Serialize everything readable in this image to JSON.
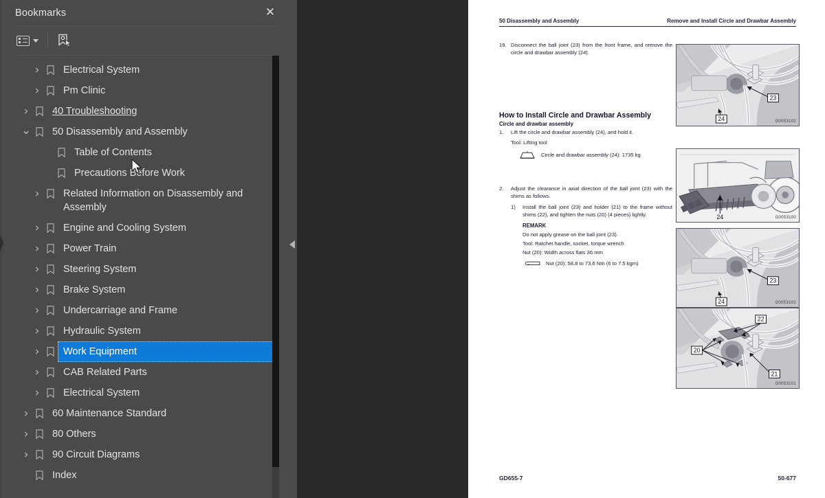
{
  "panel": {
    "title": "Bookmarks",
    "close_label": "✕",
    "toolbar": {
      "options_icon": "list-options-icon",
      "caret_icon": "chevron-down-icon",
      "new_bookmark_icon": "new-bookmark-icon"
    }
  },
  "tree": [
    {
      "label": "Electrical System",
      "level": 1,
      "twisty": "collapsed",
      "state": "normal"
    },
    {
      "label": "Pm Clinic",
      "level": 1,
      "twisty": "collapsed",
      "state": "normal"
    },
    {
      "label": "40 Troubleshooting",
      "level": 0,
      "twisty": "collapsed",
      "state": "hovered"
    },
    {
      "label": "50 Disassembly and Assembly",
      "level": 0,
      "twisty": "expanded",
      "state": "normal"
    },
    {
      "label": "Table of Contents",
      "level": 1,
      "twisty": "none",
      "state": "normal"
    },
    {
      "label": "Precautions Before Work",
      "level": 1,
      "twisty": "none",
      "state": "normal"
    },
    {
      "label": "Related Information on Disassembly and Assembly",
      "level": 1,
      "twisty": "collapsed",
      "state": "normal"
    },
    {
      "label": "Engine and Cooling System",
      "level": 1,
      "twisty": "collapsed",
      "state": "normal"
    },
    {
      "label": "Power Train",
      "level": 1,
      "twisty": "collapsed",
      "state": "normal"
    },
    {
      "label": "Steering System",
      "level": 1,
      "twisty": "collapsed",
      "state": "normal"
    },
    {
      "label": "Brake System",
      "level": 1,
      "twisty": "collapsed",
      "state": "normal"
    },
    {
      "label": "Undercarriage and Frame",
      "level": 1,
      "twisty": "collapsed",
      "state": "normal"
    },
    {
      "label": "Hydraulic System",
      "level": 1,
      "twisty": "collapsed",
      "state": "normal"
    },
    {
      "label": "Work Equipment",
      "level": 1,
      "twisty": "collapsed",
      "state": "selected"
    },
    {
      "label": "CAB Related Parts",
      "level": 1,
      "twisty": "collapsed",
      "state": "normal"
    },
    {
      "label": "Electrical System",
      "level": 1,
      "twisty": "collapsed",
      "state": "normal"
    },
    {
      "label": "60 Maintenance Standard",
      "level": 0,
      "twisty": "collapsed",
      "state": "normal"
    },
    {
      "label": "80 Others",
      "level": 0,
      "twisty": "collapsed",
      "state": "normal"
    },
    {
      "label": "90 Circuit Diagrams",
      "level": 0,
      "twisty": "collapsed",
      "state": "normal"
    },
    {
      "label": "Index",
      "level": 0,
      "twisty": "none",
      "state": "normal"
    }
  ],
  "document": {
    "header_left": "50 Disassembly and Assembly",
    "header_right": "Remove and Install Circle and Drawbar Assembly",
    "footer_left": "GD655-7",
    "footer_right": "50-677",
    "step19_num": "19.",
    "step19_text": "Disconnect the ball joint (23) from the front frame, and remove the circle and drawbar assembly (24).",
    "install_heading": "How to Install Circle and Drawbar Assembly",
    "install_subheading": "Circle and drawbar assembly",
    "step1_num": "1.",
    "step1_text": "Lift the circle and drawbar assembly (24), and hold it.",
    "step1_tool": "Tool: Lifting tool",
    "step1_weight": "Circle and drawbar assembly (24): 1735 kg",
    "step2_num": "2.",
    "step2_text": "Adjust the clearance in axial direction of the ball joint (23) with the shims as follows.",
    "step2_1_num": "1)",
    "step2_1_text": "Install the ball joint (23) and holder (21) to the frame without shims (22), and tighten the nuts (20) (4 pieces) lightly.",
    "remark_heading": "REMARK",
    "remark_line1": "Do not apply grease on the ball joint (23).",
    "remark_line2": "Tool: Ratchet handle, socket, torque wrench",
    "remark_line3": "Nut (20): Width across flats 36 mm",
    "remark_torque": "Nut (20): 58.8 to 73.6 Nm (6 to 7.5 kgm)"
  },
  "figures": [
    {
      "id": "G0053102",
      "callouts": [
        "23",
        "24"
      ],
      "kind": "ball-joint-closeup"
    },
    {
      "id": "G0053100",
      "callouts": [
        "24"
      ],
      "kind": "machine-overview"
    },
    {
      "id": "G0053102",
      "callouts": [
        "23",
        "24"
      ],
      "kind": "ball-joint-closeup"
    },
    {
      "id": "G0053101",
      "callouts": [
        "20",
        "21",
        "22"
      ],
      "kind": "ball-joint-nuts"
    }
  ],
  "colors": {
    "panel_bg": "#4a4a4a",
    "viewer_bg": "#292929",
    "selection": "#0d7ad8",
    "text": "#e2e2e2",
    "page_bg": "#ffffff"
  }
}
